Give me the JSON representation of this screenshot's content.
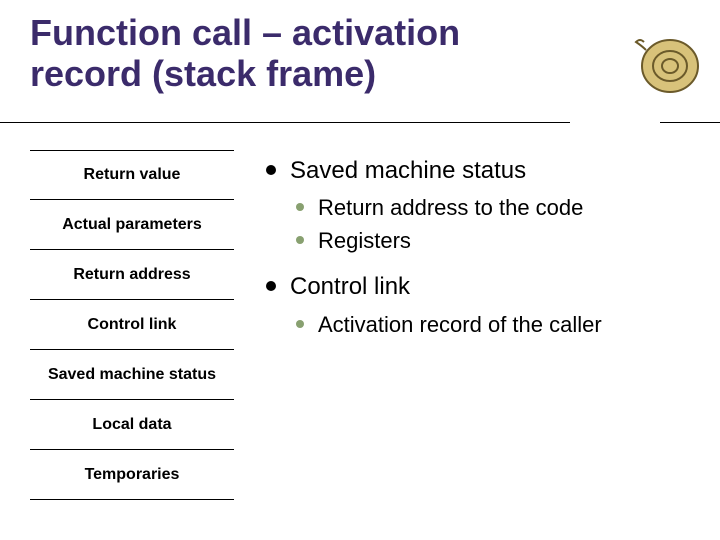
{
  "title": "Function call – activation record (stack frame)",
  "stack": {
    "cells": [
      "Return value",
      "Actual parameters",
      "Return address",
      "Control link",
      "Saved machine status",
      "Local data",
      "Temporaries"
    ]
  },
  "bullets": {
    "b1": {
      "text": "Saved machine status",
      "sub": [
        "Return address to the code",
        "Registers"
      ]
    },
    "b2": {
      "text": "Control link",
      "sub": [
        "Activation record of the caller"
      ]
    }
  },
  "icons": {
    "shell": "shell-decoration"
  }
}
